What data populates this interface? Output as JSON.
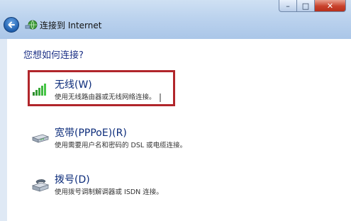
{
  "window": {
    "title": "连接到 Internet",
    "caption_min": "–",
    "caption_max": "□",
    "caption_close": "✕"
  },
  "question": "您想如何连接?",
  "options": [
    {
      "title": "无线(W)",
      "description": "使用无线路由器或无线网络连接。",
      "icon": "wireless-signal-icon"
    },
    {
      "title": "宽带(PPPoE)(R)",
      "description": "使用需要用户名和密码的 DSL 或电缆连接。",
      "icon": "broadband-modem-icon"
    },
    {
      "title": "拨号(D)",
      "description": "使用拨号调制解调器或 ISDN 连接。",
      "icon": "dialup-modem-icon"
    }
  ],
  "colors": {
    "highlight": "#b1262b",
    "title_text": "#0b2b7a",
    "question_text": "#1e3287"
  }
}
